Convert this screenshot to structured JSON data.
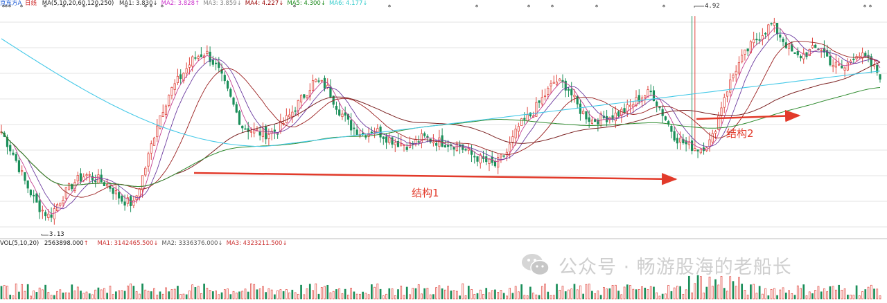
{
  "header": {
    "stock_name": "京东方A",
    "period": "日线",
    "ma_params": "MA(5,10,20,60,120,250)",
    "ma_values": [
      {
        "label": "MA1:",
        "value": "3.830",
        "arrow": "↓",
        "color": "#333333"
      },
      {
        "label": "MA2:",
        "value": "3.828",
        "arrow": "↑",
        "color": "#cc33cc"
      },
      {
        "label": "MA3:",
        "value": "3.859",
        "arrow": "↓",
        "color": "#888888"
      },
      {
        "label": "MA4:",
        "value": "4.227",
        "arrow": "↓",
        "color": "#990000"
      },
      {
        "label": "MA5:",
        "value": "4.300",
        "arrow": "↓",
        "color": "#1a8a1a"
      },
      {
        "label": "MA6:",
        "value": "4.177",
        "arrow": "↓",
        "color": "#33cccc"
      }
    ]
  },
  "volume_header": {
    "label": "VOL(5,10,20)",
    "value": "2563898.000",
    "value_arrow": "↑",
    "ma_values": [
      {
        "label": "MA1:",
        "value": "3142465.500",
        "arrow": "↓",
        "color": "#cc3333"
      },
      {
        "label": "MA2:",
        "value": "3336376.000",
        "arrow": "↓",
        "color": "#555555"
      },
      {
        "label": "MA3:",
        "value": "4323211.500",
        "arrow": "↓",
        "color": "#cc3333"
      }
    ]
  },
  "annotations": {
    "structure1": "结构1",
    "structure2": "结构2",
    "high_label": "4.92",
    "low_label": "3.13"
  },
  "watermark": {
    "text": "公众号 · 畅游股海的老船长"
  },
  "colors": {
    "up": "#e0473f",
    "down": "#1b8f5a",
    "arrow": "#e23a2a",
    "ma5": "#c23c8e",
    "ma10": "#6b3a9f",
    "ma20": "#9a1e1e",
    "ma60": "#7a2020",
    "ma120": "#2e8b2e",
    "ma250": "#45c9e8",
    "grid": "#e3e3e3"
  },
  "chart_data": {
    "type": "candlestick",
    "title": "京东方A 日线",
    "y_range_approx": [
      3.0,
      5.0
    ],
    "price_high": 4.92,
    "price_low": 3.13,
    "close_path_approx": [
      3.9,
      3.7,
      3.45,
      3.25,
      3.15,
      3.32,
      3.45,
      3.52,
      3.48,
      3.42,
      3.3,
      3.26,
      3.6,
      4.0,
      4.25,
      4.4,
      4.55,
      4.6,
      4.45,
      4.2,
      3.95,
      3.9,
      3.88,
      3.92,
      4.05,
      4.2,
      4.35,
      4.3,
      4.1,
      3.95,
      3.88,
      3.92,
      3.85,
      3.8,
      3.78,
      3.85,
      3.82,
      3.8,
      3.78,
      3.7,
      3.65,
      3.6,
      3.72,
      3.95,
      4.05,
      4.2,
      4.35,
      4.3,
      4.1,
      4.0,
      4.02,
      4.05,
      4.1,
      4.2,
      4.25,
      4.05,
      3.85,
      3.78,
      3.75,
      3.82,
      4.2,
      4.45,
      4.62,
      4.75,
      4.85,
      4.7,
      4.55,
      4.6,
      4.65,
      4.5,
      4.45,
      4.6,
      4.52,
      4.4
    ],
    "moving_averages": [
      "MA5",
      "MA10",
      "MA20",
      "MA60",
      "MA120",
      "MA250"
    ],
    "annotations": [
      {
        "text": "结构1",
        "type": "arrow"
      },
      {
        "text": "结构2",
        "type": "arrow"
      }
    ]
  }
}
